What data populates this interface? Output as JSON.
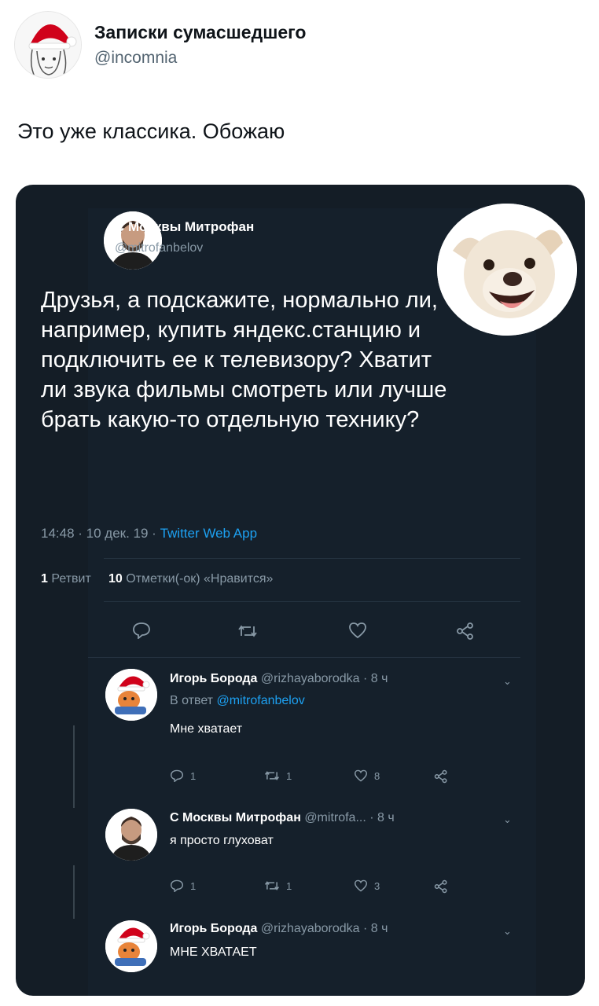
{
  "outer_tweet": {
    "author_name": "Записки сумасшедшего",
    "author_handle": "@incomnia",
    "text": "Это уже классика. Обожаю"
  },
  "screenshot": {
    "main_tweet": {
      "author_name": "С Москвы Митрофан",
      "author_handle": "@mitrofanbelov",
      "text": "Друзья, а подскажите, нормально ли, например, купить яндекс.станцию и подключить ее к телевизору? Хватит ли звука фильмы смотреть или лучше брать какую-то отдельную технику?",
      "time": "14:48 · 10 дек. 19 · ",
      "source": "Twitter Web App",
      "retweets_count": "1",
      "retweets_label": "Ретвит",
      "likes_count": "10",
      "likes_label": "Отметки(-ок) «Нравится»"
    },
    "replies": [
      {
        "author_name": "Игорь Борода",
        "author_handle": "@rizhayaborodka · 8 ч",
        "reply_to_label": "В ответ",
        "reply_to_mention": "@mitrofanbelov",
        "text": "Мне хватает",
        "reply_count": "1",
        "retweet_count": "1",
        "like_count": "8"
      },
      {
        "author_name": "С Москвы Митрофан",
        "author_handle": "@mitrofa... · 8 ч",
        "text": "я просто глуховат",
        "reply_count": "1",
        "retweet_count": "1",
        "like_count": "3"
      },
      {
        "author_name": "Игорь Борода",
        "author_handle": "@rizhayaborodka · 8 ч",
        "text": "МНЕ ХВАТАЕТ"
      }
    ]
  },
  "icons": [
    "reply-icon",
    "retweet-icon",
    "like-icon",
    "share-icon",
    "chevron-down-icon"
  ],
  "colors": {
    "background_dark": "#15202b",
    "frame_dark": "#141d26",
    "text_secondary": "#8899a6",
    "link_blue": "#1da1f2",
    "divider": "#253341"
  }
}
